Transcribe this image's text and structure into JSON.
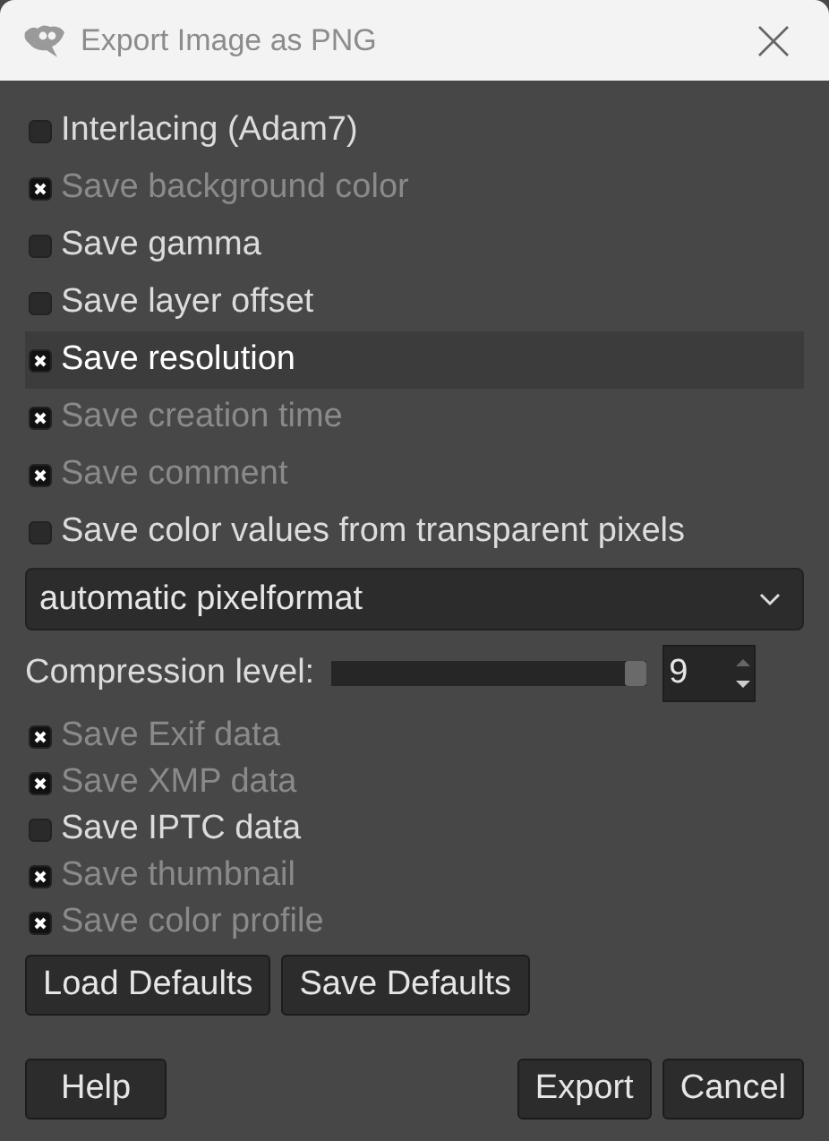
{
  "window": {
    "title": "Export Image as PNG"
  },
  "options": [
    {
      "label": "Interlacing (Adam7)",
      "checked": false,
      "highlighted": false
    },
    {
      "label": "Save background color",
      "checked": true,
      "highlighted": false
    },
    {
      "label": "Save gamma",
      "checked": false,
      "highlighted": false
    },
    {
      "label": "Save layer offset",
      "checked": false,
      "highlighted": false
    },
    {
      "label": "Save resolution",
      "checked": true,
      "highlighted": true
    },
    {
      "label": "Save creation time",
      "checked": true,
      "highlighted": false
    },
    {
      "label": "Save comment",
      "checked": true,
      "highlighted": false
    },
    {
      "label": "Save color values from transparent pixels",
      "checked": false,
      "highlighted": false
    }
  ],
  "pixel_format": {
    "value": "automatic pixelformat"
  },
  "compression": {
    "label": "Compression level:",
    "level": 1.0,
    "value": "9"
  },
  "metadata": [
    {
      "label": "Save Exif data",
      "checked": true
    },
    {
      "label": "Save XMP data",
      "checked": true
    },
    {
      "label": "Save IPTC data",
      "checked": false
    },
    {
      "label": "Save thumbnail",
      "checked": true
    },
    {
      "label": "Save color profile",
      "checked": true
    }
  ],
  "default_buttons": [
    "Load Defaults",
    "Save Defaults"
  ],
  "buttons": {
    "left": [
      "Help"
    ],
    "right": [
      "Export",
      "Cancel"
    ]
  }
}
